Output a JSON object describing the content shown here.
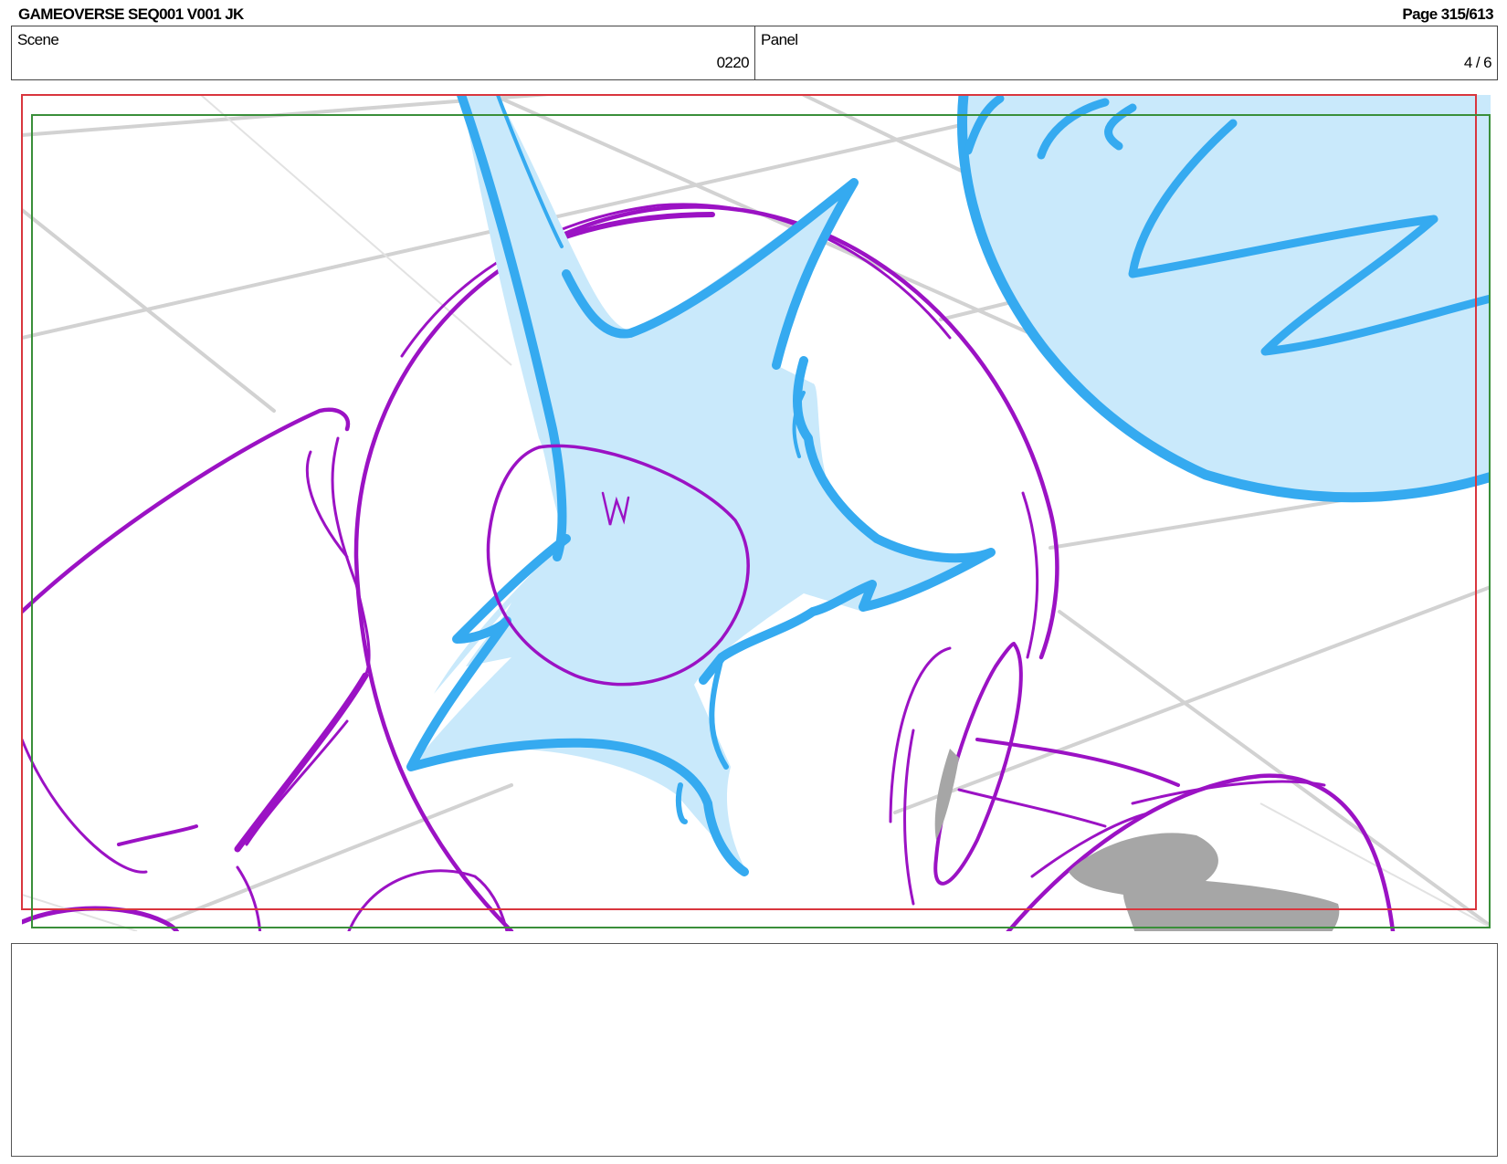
{
  "header": {
    "title": "GAMEOVERSE SEQ001 V001 JK",
    "page": "Page 315/613"
  },
  "info": {
    "scene_label": "Scene",
    "scene_value": "0220",
    "panel_label": "Panel",
    "panel_value": "4 / 6"
  },
  "colors": {
    "safe_frame": "#d9363e",
    "camera_frame": "#3a8f3a",
    "character_line": "#9b12c4",
    "effect_line": "#35aaf0",
    "effect_fill": "#c9e9fb",
    "grid_line": "#d2d2d2",
    "shadow_fill": "#a6a6a6"
  },
  "notes": {
    "text": ""
  }
}
